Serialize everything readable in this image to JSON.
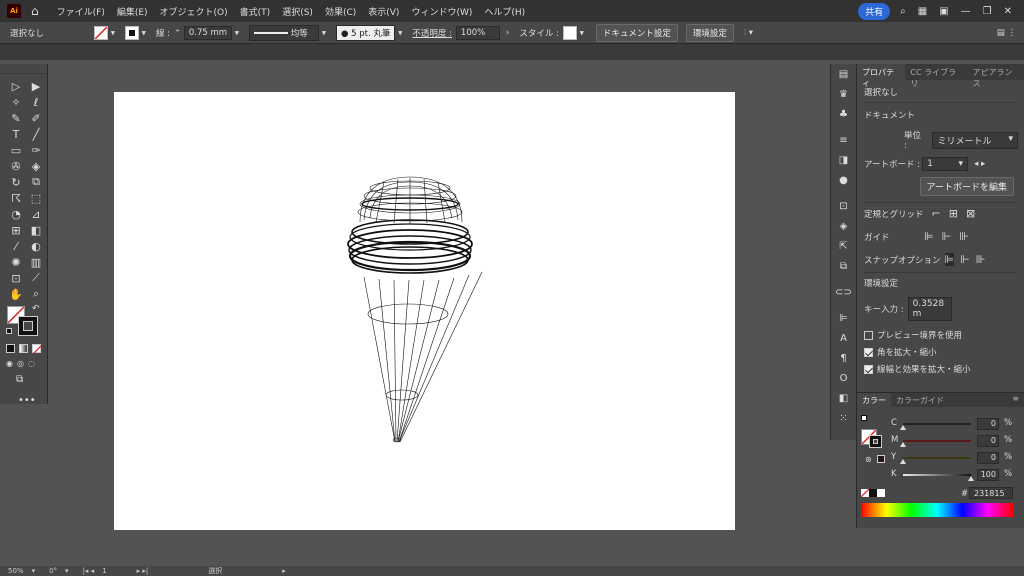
{
  "app": {
    "logo": "Ai"
  },
  "menu": [
    "ファイル(F)",
    "編集(E)",
    "オブジェクト(O)",
    "書式(T)",
    "選択(S)",
    "効果(C)",
    "表示(V)",
    "ウィンドウ(W)",
    "ヘルプ(H)"
  ],
  "share_label": "共有",
  "control_bar": {
    "selection": "選択なし",
    "stroke_label": "線 :",
    "stroke_weight": "0.75 mm",
    "line_style": "均等",
    "brush": "5 pt. 丸筆",
    "opacity_label": "不透明度 :",
    "opacity": "100%",
    "style_label": "スタイル :",
    "doc_setup": "ドキュメント設定",
    "prefs": "環境設定"
  },
  "properties": {
    "tabs": [
      "プロパティ",
      "CC ライブラリ",
      "アピアランス"
    ],
    "no_selection": "選択なし",
    "document_label": "ドキュメント",
    "unit_label": "単位 :",
    "unit_value": "ミリメートル",
    "artboard_label": "アートボード :",
    "artboard_value": "1",
    "edit_artboard": "アートボードを編集",
    "rulers_grid": "定規とグリッド",
    "guides": "ガイド",
    "snap": "スナップオプション",
    "prefs_label": "環境設定",
    "key_input_label": "キー入力 :",
    "key_input_value": "0.3528 m",
    "preview_bounds": "プレビュー境界を使用",
    "scale_corners": "角を拡大・縮小",
    "scale_strokes": "線幅と効果を拡大・縮小"
  },
  "color_panel": {
    "tabs": [
      "カラー",
      "カラーガイド"
    ],
    "channels": [
      {
        "label": "C",
        "value": "0",
        "unit": "%"
      },
      {
        "label": "M",
        "value": "0",
        "unit": "%"
      },
      {
        "label": "Y",
        "value": "0",
        "unit": "%"
      },
      {
        "label": "K",
        "value": "100",
        "unit": "%"
      }
    ],
    "hex_value": "231815"
  },
  "status": {
    "zoom": "50%",
    "rotation": "0°",
    "artboard": "1",
    "tool": "選択"
  }
}
